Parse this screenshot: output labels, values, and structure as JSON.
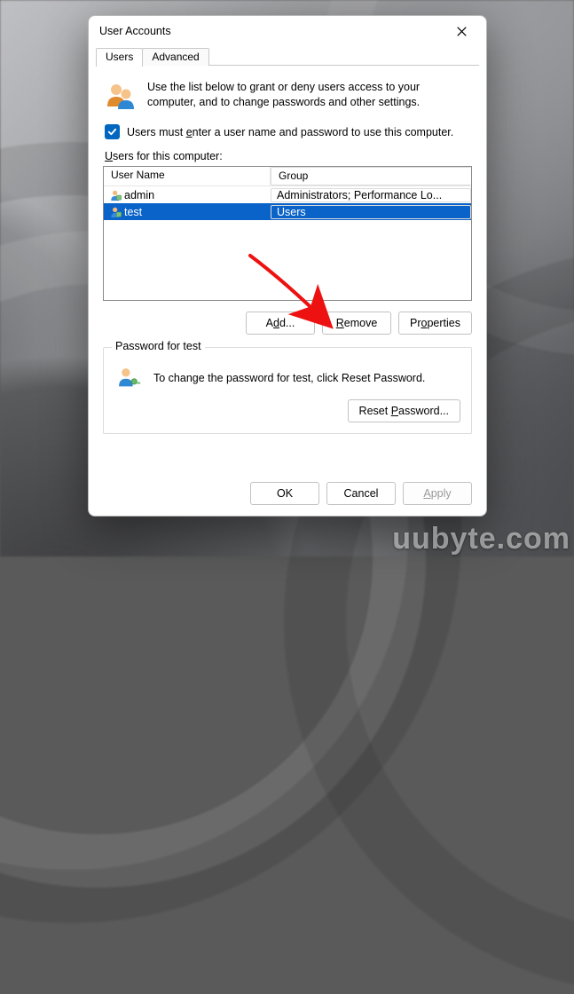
{
  "watermark": "uubyte.com",
  "dialog": {
    "title": "User Accounts",
    "tabs": [
      {
        "label": "Users",
        "active": true
      },
      {
        "label": "Advanced",
        "active": false
      }
    ],
    "intro": "Use the list below to grant or deny users access to your computer, and to change passwords and other settings.",
    "checkbox": {
      "checked": true,
      "label_pre": "Users must ",
      "label_u": "e",
      "label_post": "nter a user name and password to use this computer."
    },
    "list_label_u": "U",
    "list_label_post": "sers for this computer:",
    "columns": {
      "name": "User Name",
      "group": "Group"
    },
    "users": [
      {
        "name": "admin",
        "group": "Administrators; Performance Lo...",
        "selected": false
      },
      {
        "name": "test",
        "group": "Users",
        "selected": true
      }
    ],
    "buttons": {
      "add_pre": "A",
      "add_u": "d",
      "add_post": "d...",
      "remove_u": "R",
      "remove_post": "emove",
      "props_pre": "Pr",
      "props_u": "o",
      "props_post": "perties"
    },
    "pwgroup": {
      "legend": "Password for test",
      "text": "To change the password for test, click Reset Password.",
      "reset_pre": "Reset ",
      "reset_u": "P",
      "reset_post": "assword..."
    },
    "dlg_buttons": {
      "ok": "OK",
      "cancel": "Cancel",
      "apply_u": "A",
      "apply_post": "pply",
      "apply_enabled": false
    }
  }
}
